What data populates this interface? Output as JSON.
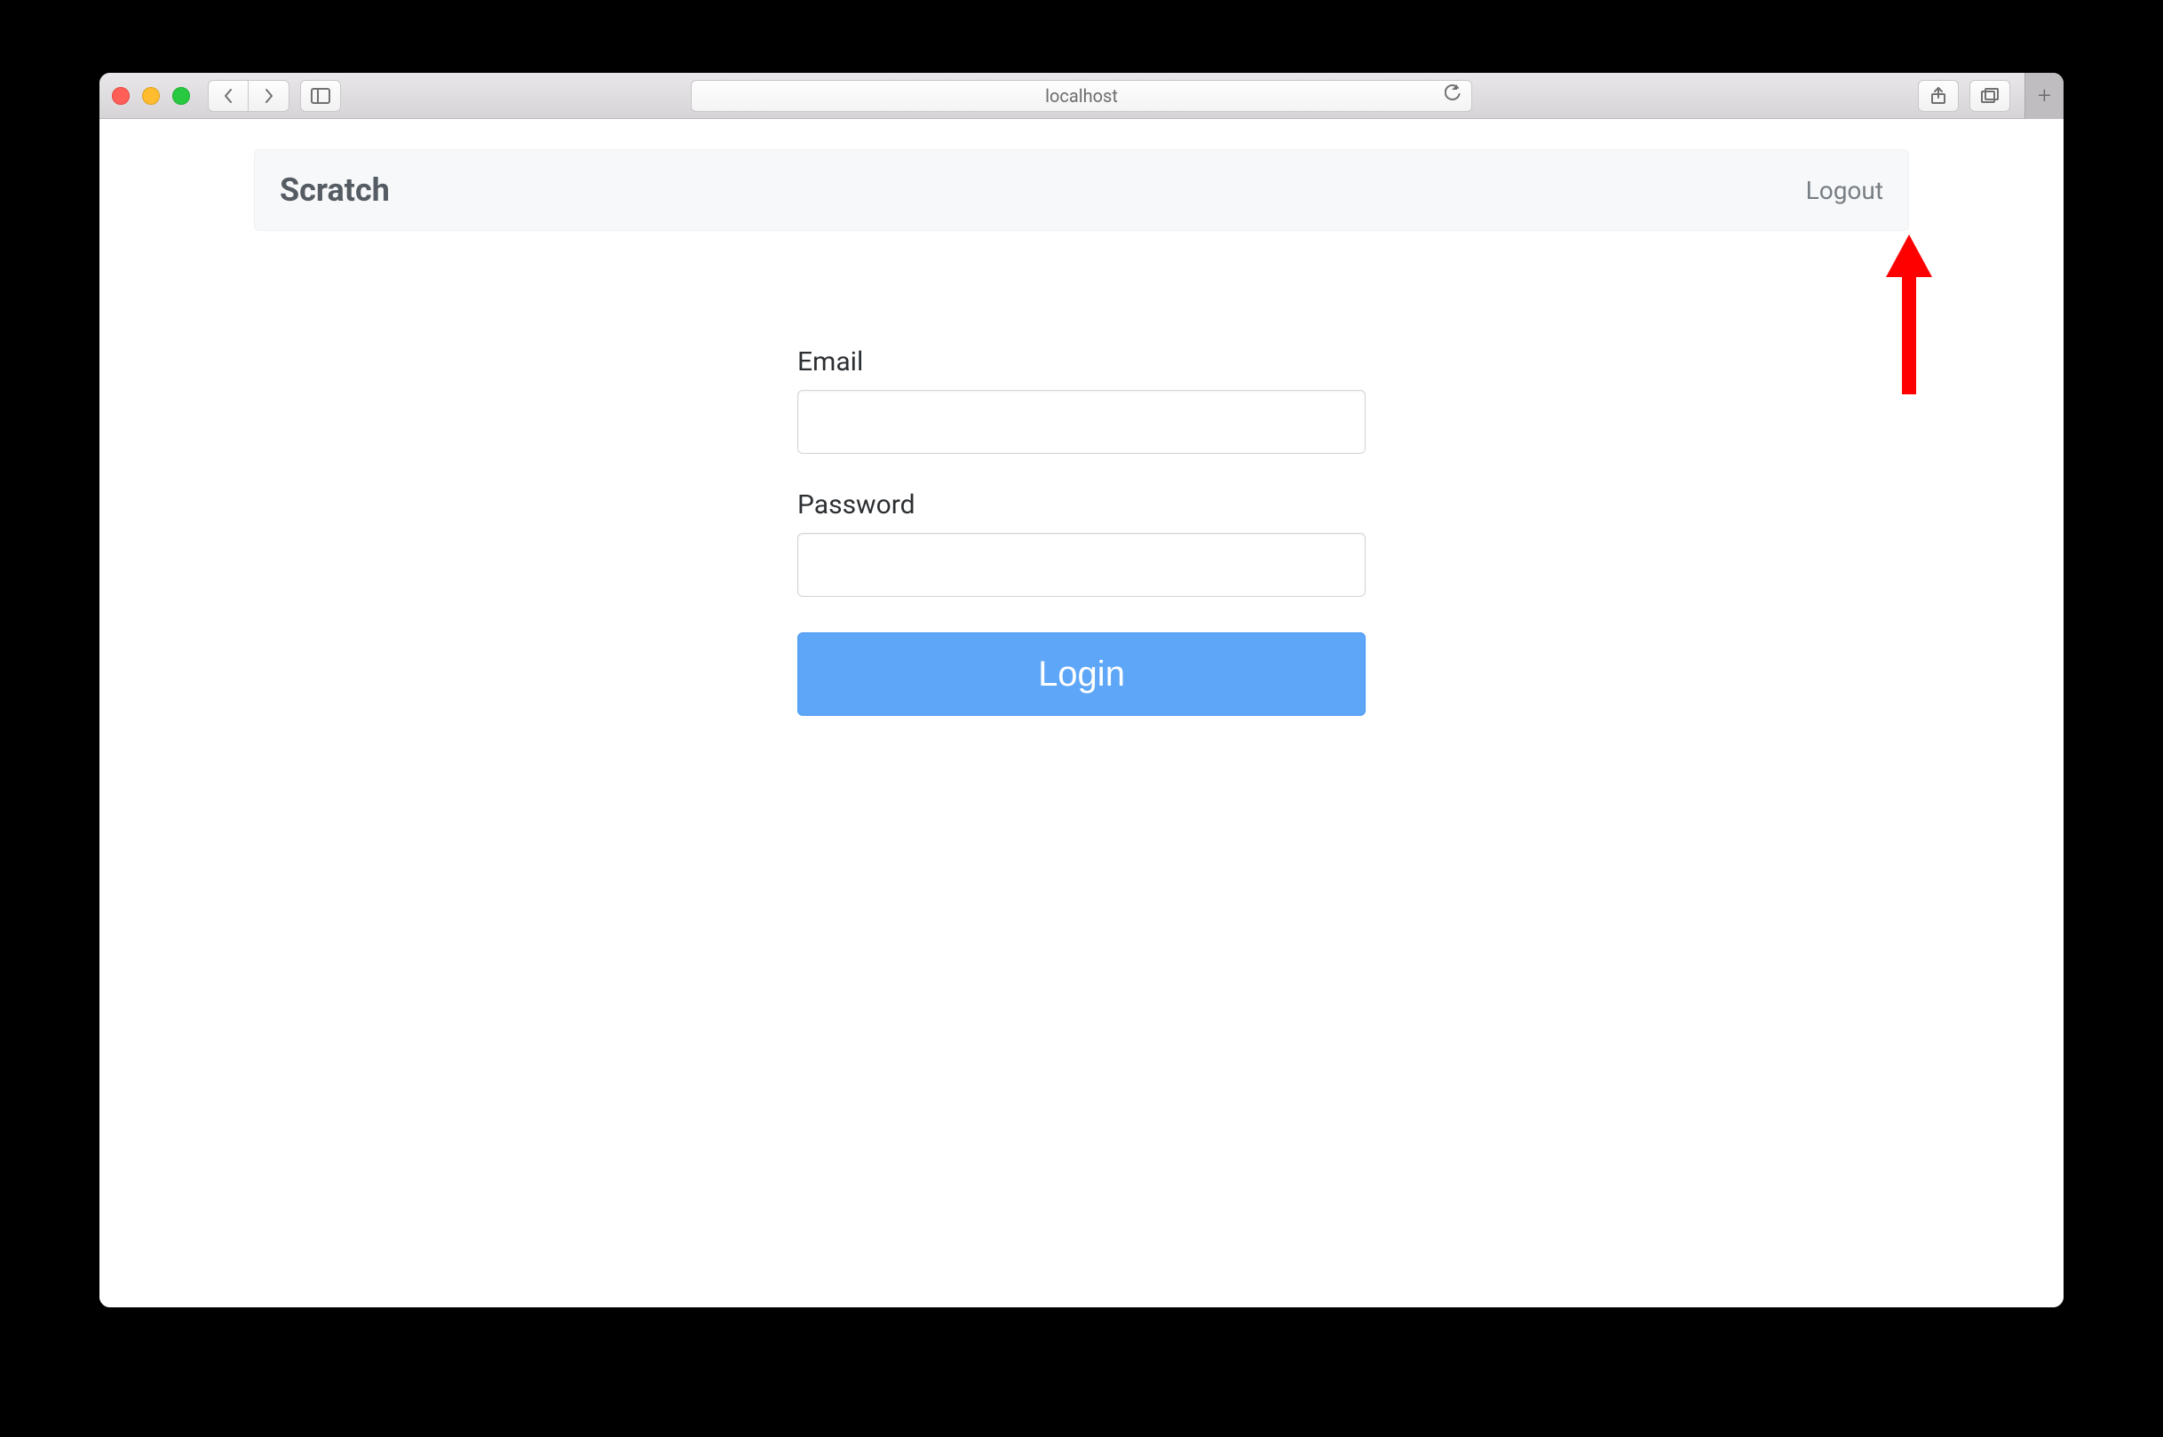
{
  "browser": {
    "address": "localhost"
  },
  "app": {
    "brand": "Scratch",
    "logout_label": "Logout"
  },
  "form": {
    "email_label": "Email",
    "email_value": "",
    "password_label": "Password",
    "password_value": "",
    "submit_label": "Login"
  }
}
